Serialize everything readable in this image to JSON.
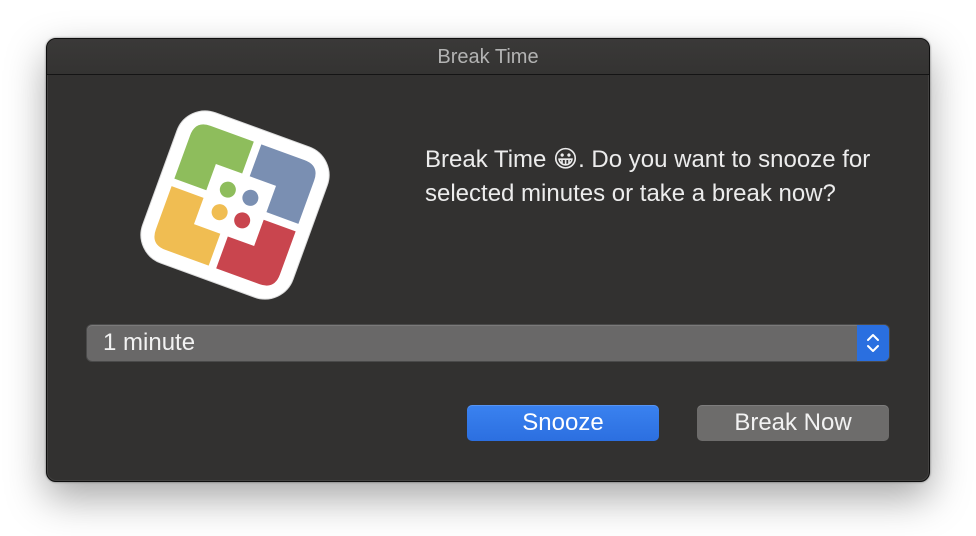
{
  "window": {
    "title": "Break Time"
  },
  "app_icon": {
    "name": "break-time-app-icon",
    "colors": {
      "green": "#8ebd5c",
      "blue": "#7a8fb2",
      "yellow": "#f0bd52",
      "red": "#c9454e",
      "background": "#ffffff"
    }
  },
  "message": {
    "text_before_emoji": "Break Time ",
    "emoji": "😀",
    "text_after_emoji": ". Do you want to snooze for selected minutes or take a break now?"
  },
  "snooze_select": {
    "selected": "1 minute"
  },
  "buttons": {
    "snooze_label": "Snooze",
    "break_now_label": "Break Now"
  },
  "colors": {
    "accent": "#2c6fe0",
    "dialog_background": "#323130",
    "secondary_button": "#6d6c6b"
  }
}
